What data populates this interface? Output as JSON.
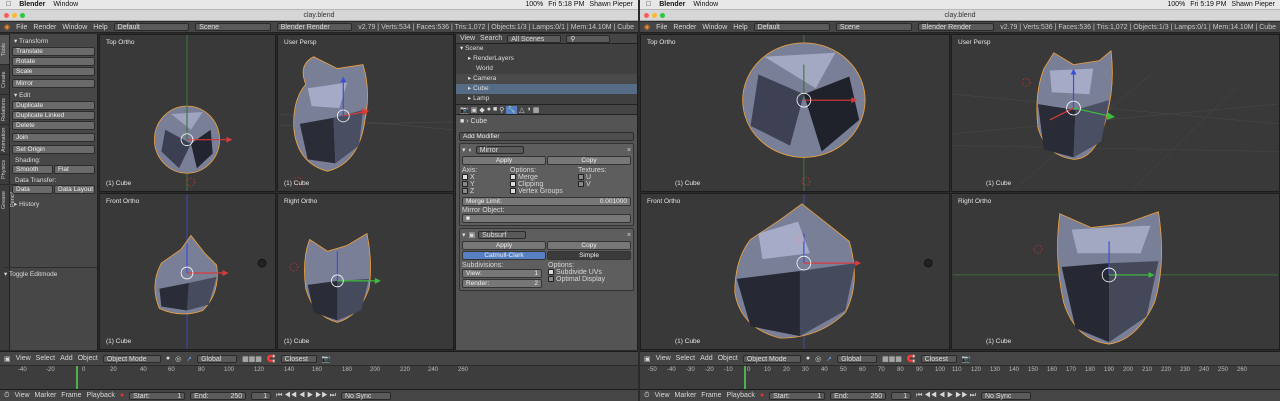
{
  "macbar": {
    "left": {
      "app": "Blender",
      "menu": "Window"
    },
    "right": {
      "battery": "100%",
      "time": "Fri 5:18 PM",
      "user": "Shawn Pieper"
    },
    "right2": {
      "battery": "100%",
      "time": "Fri 5:19 PM",
      "user": "Shawn Pieper"
    }
  },
  "window_title": "clay.blend",
  "info_header": {
    "menus": [
      "File",
      "Render",
      "Window",
      "Help"
    ],
    "layout": "Default",
    "scene": "Scene",
    "engine": "Blender Render",
    "stats_left": "v2.79 | Verts:534 | Faces:536 | Tris:1,072 | Objects:1/3 | Lamps:0/1 | Mem:14.10M | Cube",
    "stats_right": "v2.79 | Verts:536 | Faces:536 | Tris:1,072 | Objects:1/3 | Lamps:0/1 | Mem:14.10M | Cube"
  },
  "viewports": {
    "top_ortho": "Top Ortho",
    "user_persp": "User Persp",
    "front_ortho": "Front Ortho",
    "right_ortho": "Right Ortho",
    "object_label": "(1) Cube"
  },
  "toolshelf": {
    "tabs": [
      "Tools",
      "Create",
      "Relations",
      "Animation",
      "Physics",
      "Grease Pencil"
    ],
    "transform_header": "Transform",
    "translate": "Translate",
    "rotate": "Rotate",
    "scale": "Scale",
    "mirror": "Mirror",
    "edit_header": "Edit",
    "duplicate": "Duplicate",
    "duplicate_linked": "Duplicate Linked",
    "delete": "Delete",
    "join": "Join",
    "set_origin": "Set Origin",
    "shading_label": "Shading:",
    "smooth": "Smooth",
    "flat": "Flat",
    "data_transfer_label": "Data Transfer:",
    "data": "Data",
    "data_layout": "Data Layout",
    "history": "History",
    "toggle_editmode": "Toggle Editmode"
  },
  "outliner": {
    "header": {
      "view": "View",
      "search": "Search",
      "scenes": "All Scenes"
    },
    "items": [
      "Scene",
      "RenderLayers",
      "World",
      "Camera",
      "Cube",
      "Lamp"
    ]
  },
  "properties": {
    "breadcrumb": "Cube",
    "add_modifier": "Add Modifier",
    "mirror": {
      "name": "Mirror",
      "apply": "Apply",
      "copy": "Copy",
      "axis_label": "Axis:",
      "options_label": "Options:",
      "textures_label": "Textures:",
      "x": "X",
      "y": "Y",
      "z": "Z",
      "merge": "Merge",
      "clipping": "Clipping",
      "vertex_groups": "Vertex Groups",
      "u": "U",
      "v": "V",
      "merge_limit_label": "Merge Limit:",
      "merge_limit_value": "0.001000",
      "mirror_object_label": "Mirror Object:"
    },
    "subsurf": {
      "name": "Subsurf",
      "apply": "Apply",
      "copy": "Copy",
      "catmull": "Catmull-Clark",
      "simple": "Simple",
      "subdivisions_label": "Subdivisions:",
      "options_label": "Options:",
      "view_label": "View:",
      "view_value": "1",
      "render_label": "Render:",
      "render_value": "2",
      "subdivide_uvs": "Subdivide UVs",
      "optimal_display": "Optimal Display"
    }
  },
  "view3d_header": {
    "view": "View",
    "select": "Select",
    "add": "Add",
    "object": "Object",
    "mode": "Object Mode",
    "orientation": "Global",
    "snap": "Closest"
  },
  "timeline": {
    "ticks_left": [
      "-40",
      "-20",
      "0",
      "20",
      "40",
      "60",
      "80",
      "100",
      "120",
      "140",
      "160",
      "180",
      "200",
      "220",
      "240",
      "260"
    ],
    "ticks_right": [
      "-50",
      "-40",
      "-30",
      "-20",
      "-10",
      "0",
      "10",
      "20",
      "30",
      "40",
      "50",
      "60",
      "70",
      "80",
      "90",
      "100",
      "110",
      "120",
      "130",
      "140",
      "150",
      "160",
      "170",
      "180",
      "190",
      "200",
      "210",
      "220",
      "230",
      "240",
      "250",
      "260"
    ],
    "view": "View",
    "marker": "Marker",
    "frame": "Frame",
    "playback": "Playback",
    "start_label": "Start:",
    "start_value": "1",
    "end_label": "End:",
    "end_value": "250",
    "current": "1",
    "sync": "No Sync"
  },
  "colors": {
    "accent": "#5680c2",
    "selection": "#f2a33a",
    "x_axis": "#d83a3a",
    "y_axis": "#3cbf3c",
    "z_axis": "#3a4fd8"
  }
}
